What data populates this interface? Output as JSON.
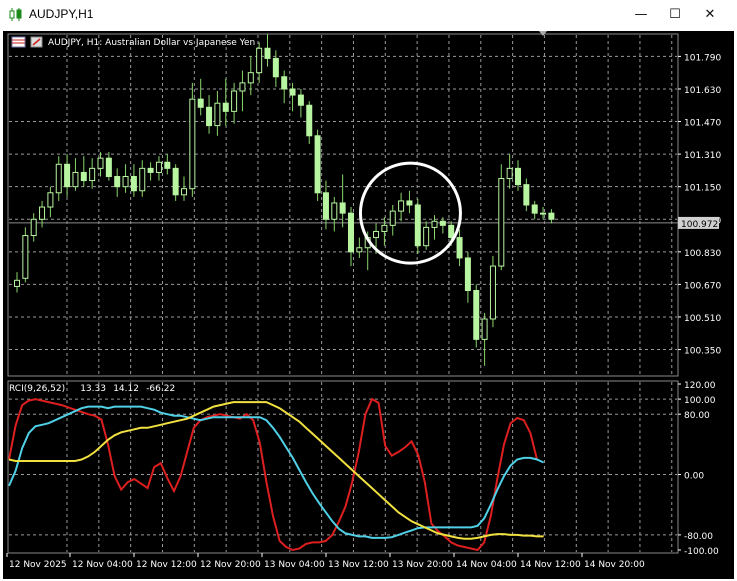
{
  "window": {
    "title": "AUDJPY,H1",
    "minimize_icon": "minimize-icon",
    "maximize_icon": "maximize-icon",
    "close_icon": "close-icon"
  },
  "colors": {
    "background": "#000000",
    "grid": "#9a9a9a",
    "axis_text": "#ffffff",
    "candle_up": "#000000",
    "candle_down": "#b8f5a0",
    "wick": "#8ad66a",
    "price_badge_bg": "#d0d0d0",
    "current_price_line": "#8c8c8c",
    "rci_short": "#dd1f1f",
    "rci_middle": "#4fd0e6",
    "rci_long": "#f0e040",
    "annotation_circle": "#ffffff"
  },
  "chart_data": [
    {
      "type": "candlestick",
      "header": "AUDJPY, H1:  Australian Dollar vs Japanese Yen",
      "ylim": [
        100.22,
        101.9
      ],
      "price_ticks": [
        "101.790",
        "101.630",
        "101.470",
        "101.310",
        "101.150",
        "100.990",
        "100.830",
        "100.670",
        "100.510",
        "100.350"
      ],
      "current_price": "100.972",
      "time_ticks": [
        "12 Nov 2025",
        "12 Nov 04:00",
        "12 Nov 12:00",
        "12 Nov 20:00",
        "13 Nov 04:00",
        "13 Nov 12:00",
        "13 Nov 20:00",
        "14 Nov 04:00",
        "14 Nov 12:00",
        "14 Nov 20:00"
      ],
      "ohlc": [
        [
          100.66,
          100.73,
          100.63,
          100.69
        ],
        [
          100.7,
          100.95,
          100.68,
          100.91
        ],
        [
          100.91,
          101.02,
          100.88,
          100.99
        ],
        [
          100.99,
          101.08,
          100.95,
          101.05
        ],
        [
          101.05,
          101.15,
          101.0,
          101.12
        ],
        [
          101.12,
          101.3,
          101.08,
          101.26
        ],
        [
          101.26,
          101.31,
          101.1,
          101.15
        ],
        [
          101.15,
          101.29,
          101.13,
          101.22
        ],
        [
          101.22,
          101.3,
          101.15,
          101.18
        ],
        [
          101.18,
          101.29,
          101.14,
          101.24
        ],
        [
          101.24,
          101.32,
          101.2,
          101.29
        ],
        [
          101.29,
          101.32,
          101.18,
          101.2
        ],
        [
          101.2,
          101.24,
          101.1,
          101.15
        ],
        [
          101.15,
          101.26,
          101.12,
          101.2
        ],
        [
          101.2,
          101.26,
          101.1,
          101.13
        ],
        [
          101.13,
          101.28,
          101.1,
          101.24
        ],
        [
          101.24,
          101.27,
          101.18,
          101.22
        ],
        [
          101.22,
          101.3,
          101.18,
          101.27
        ],
        [
          101.27,
          101.31,
          101.21,
          101.24
        ],
        [
          101.24,
          101.26,
          101.08,
          101.11
        ],
        [
          101.11,
          101.2,
          101.08,
          101.14
        ],
        [
          101.14,
          101.66,
          101.1,
          101.58
        ],
        [
          101.58,
          101.68,
          101.5,
          101.54
        ],
        [
          101.54,
          101.6,
          101.41,
          101.45
        ],
        [
          101.45,
          101.62,
          101.4,
          101.56
        ],
        [
          101.56,
          101.68,
          101.45,
          101.52
        ],
        [
          101.52,
          101.66,
          101.46,
          101.62
        ],
        [
          101.62,
          101.72,
          101.52,
          101.66
        ],
        [
          101.66,
          101.79,
          101.6,
          101.71
        ],
        [
          101.71,
          101.86,
          101.66,
          101.83
        ],
        [
          101.83,
          101.9,
          101.74,
          101.78
        ],
        [
          101.78,
          101.82,
          101.64,
          101.69
        ],
        [
          101.69,
          101.72,
          101.56,
          101.63
        ],
        [
          101.63,
          101.66,
          101.52,
          101.6
        ],
        [
          101.6,
          101.63,
          101.49,
          101.55
        ],
        [
          101.55,
          101.57,
          101.36,
          101.4
        ],
        [
          101.4,
          101.43,
          101.08,
          101.12
        ],
        [
          101.12,
          101.18,
          100.94,
          100.99
        ],
        [
          100.99,
          101.1,
          100.93,
          101.07
        ],
        [
          101.07,
          101.21,
          100.95,
          101.02
        ],
        [
          101.02,
          101.05,
          100.76,
          100.83
        ],
        [
          100.83,
          100.9,
          100.8,
          100.85
        ],
        [
          100.85,
          100.93,
          100.74,
          100.9
        ],
        [
          100.9,
          100.97,
          100.82,
          100.93
        ],
        [
          100.93,
          101.0,
          100.86,
          100.96
        ],
        [
          100.96,
          101.06,
          100.91,
          101.03
        ],
        [
          101.03,
          101.12,
          100.98,
          101.08
        ],
        [
          101.08,
          101.13,
          101.02,
          101.06
        ],
        [
          101.06,
          101.09,
          100.82,
          100.86
        ],
        [
          100.86,
          100.98,
          100.84,
          100.95
        ],
        [
          100.95,
          101.01,
          100.89,
          100.98
        ],
        [
          100.98,
          101.0,
          100.92,
          100.96
        ],
        [
          100.96,
          100.98,
          100.86,
          100.9
        ],
        [
          100.9,
          100.94,
          100.76,
          100.8
        ],
        [
          100.8,
          100.83,
          100.58,
          100.64
        ],
        [
          100.64,
          100.67,
          100.36,
          100.4
        ],
        [
          100.4,
          100.53,
          100.27,
          100.5
        ],
        [
          100.5,
          100.81,
          100.46,
          100.76
        ],
        [
          100.76,
          101.26,
          100.74,
          101.19
        ],
        [
          101.19,
          101.31,
          101.14,
          101.24
        ],
        [
          101.24,
          101.28,
          101.13,
          101.16
        ],
        [
          101.16,
          101.19,
          101.03,
          101.06
        ],
        [
          101.06,
          101.08,
          100.99,
          101.02
        ],
        [
          101.02,
          101.05,
          100.99,
          101.02
        ],
        [
          101.02,
          101.04,
          100.97,
          100.99
        ]
      ],
      "annotation": "circle"
    },
    {
      "type": "line",
      "header_name": "RCI(9,26,52)",
      "header_values": [
        "13.33",
        "14.12",
        "-66.22"
      ],
      "ylim": [
        -104,
        124
      ],
      "y_ticks": [
        "120.00",
        "100.00",
        "80.00",
        "0.00",
        "-80.00",
        "-100.00"
      ],
      "series": [
        {
          "key": "rci_short",
          "values": [
            20,
            65,
            92,
            98,
            100,
            98,
            96,
            94,
            92,
            89,
            86,
            83,
            80,
            78,
            73,
            40,
            -2,
            -20,
            -10,
            -6,
            -12,
            -18,
            10,
            15,
            -5,
            -22,
            -2,
            30,
            62,
            72,
            76,
            78,
            80,
            78,
            76,
            74,
            80,
            72,
            42,
            -10,
            -55,
            -88,
            -96,
            -100,
            -98,
            -92,
            -90,
            -90,
            -88,
            -80,
            -62,
            -42,
            -10,
            30,
            80,
            100,
            95,
            38,
            25,
            30,
            36,
            44,
            26,
            -10,
            -65,
            -75,
            -82,
            -90,
            -94,
            -96,
            -98,
            -100,
            -90,
            -55,
            -5,
            40,
            68,
            75,
            72,
            55,
            20
          ]
        },
        {
          "key": "rci_middle",
          "values": [
            -15,
            5,
            35,
            55,
            64,
            66,
            68,
            72,
            76,
            80,
            84,
            88,
            90,
            90,
            90,
            88,
            90,
            90,
            90,
            90,
            90,
            88,
            86,
            82,
            80,
            78,
            78,
            76,
            74,
            72,
            74,
            76,
            76,
            76,
            76,
            76,
            76,
            76,
            76,
            72,
            62,
            50,
            36,
            22,
            6,
            -10,
            -25,
            -38,
            -50,
            -62,
            -72,
            -78,
            -80,
            -82,
            -82,
            -84,
            -84,
            -84,
            -83,
            -80,
            -77,
            -74,
            -71,
            -70,
            -70,
            -70,
            -70,
            -70,
            -70,
            -70,
            -70,
            -68,
            -58,
            -40,
            -20,
            -2,
            12,
            20,
            22,
            22,
            20,
            16
          ]
        },
        {
          "key": "rci_long",
          "values": [
            20,
            18,
            18,
            18,
            18,
            18,
            18,
            18,
            18,
            18,
            18,
            20,
            24,
            30,
            38,
            46,
            52,
            56,
            58,
            60,
            62,
            62,
            64,
            66,
            68,
            70,
            72,
            74,
            78,
            82,
            86,
            90,
            92,
            94,
            96,
            96,
            96,
            96,
            96,
            96,
            92,
            88,
            82,
            76,
            70,
            62,
            54,
            46,
            38,
            30,
            22,
            14,
            6,
            -2,
            -10,
            -18,
            -26,
            -34,
            -42,
            -50,
            -56,
            -62,
            -66,
            -70,
            -74,
            -78,
            -80,
            -82,
            -84,
            -85,
            -85,
            -84,
            -82,
            -80,
            -79,
            -79,
            -80,
            -80,
            -81,
            -81,
            -82,
            -82
          ]
        }
      ]
    }
  ]
}
